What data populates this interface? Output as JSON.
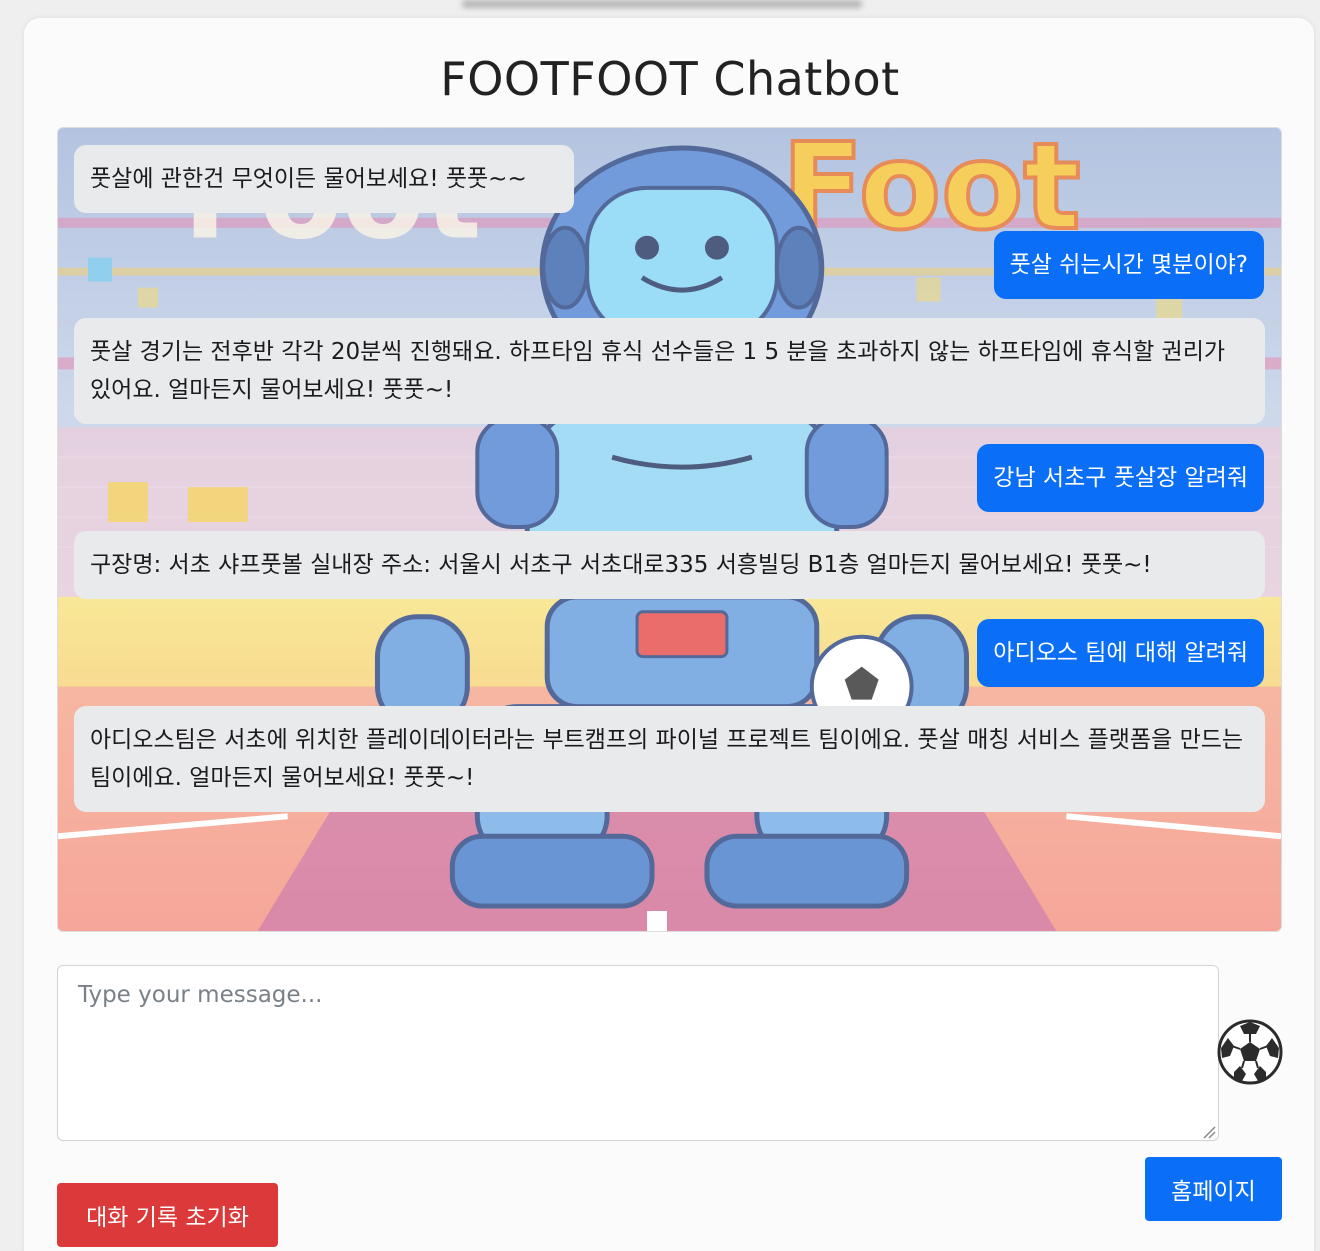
{
  "header": {
    "title": "FOOTFOOT Chatbot"
  },
  "chat": {
    "messages": [
      {
        "role": "bot",
        "text": "풋살에 관한건 무엇이든 물어보세요! 풋풋~~"
      },
      {
        "role": "user",
        "text": "풋살 쉬는시간 몇분이야?"
      },
      {
        "role": "bot",
        "text": "풋살 경기는 전후반 각각 20분씩 진행돼요. 하프타임 휴식 선수들은 1 5 분을 초과하지 않는 하프타임에 휴식할 권리가 있어요. 얼마든지 물어보세요! 풋풋~!"
      },
      {
        "role": "user",
        "text": "강남 서초구 풋살장 알려줘"
      },
      {
        "role": "bot",
        "text": "구장명: 서초 샤프풋볼 실내장 주소: 서울시 서초구 서초대로335 서흥빌딩 B1층 얼마든지 물어보세요! 풋풋~!"
      },
      {
        "role": "user",
        "text": "아디오스 팀에 대해 알려줘"
      },
      {
        "role": "bot",
        "text": "아디오스팀은 서초에 위치한 플레이데이터라는 부트캠프의 파이널 프로젝트 팀이에요. 풋살 매칭 서비스 플랫폼을 만드는 팀이에요. 얼마든지 물어보세요! 풋풋~!"
      }
    ],
    "background_logo": "Foot Foot"
  },
  "input": {
    "placeholder": "Type your message..."
  },
  "send": {
    "icon": "soccer-ball-icon"
  },
  "buttons": {
    "reset_label": "대화 기록 초기화",
    "home_label": "홈페이지"
  },
  "colors": {
    "user_bubble": "#0a6ef6",
    "bot_bubble": "#e9eaec",
    "reset": "#dc3a3a",
    "home": "#0a6ef6"
  }
}
